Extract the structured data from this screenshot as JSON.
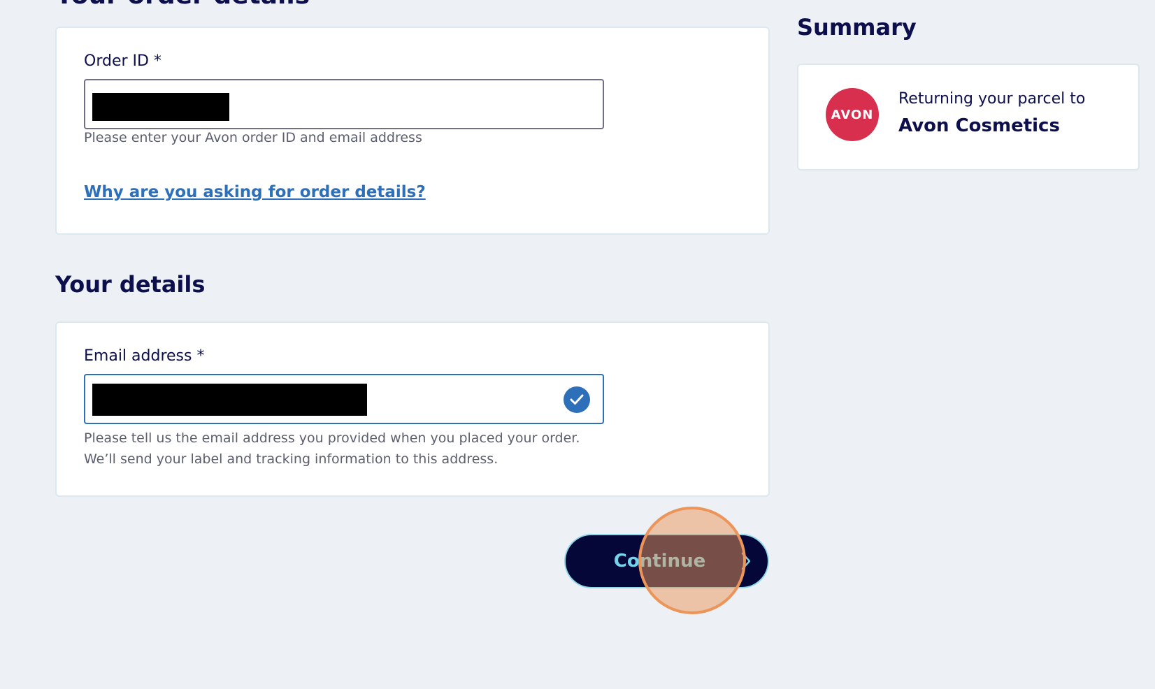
{
  "order_section": {
    "heading": "Your order details",
    "order_id_label": "Order ID *",
    "order_id_hint": "Please enter your Avon order ID and email address",
    "why_link": "Why are you asking for order details?"
  },
  "details_section": {
    "heading": "Your details",
    "email_label": "Email address *",
    "email_hint_line1": "Please tell us the email address you provided when you placed your order.",
    "email_hint_line2": "We’ll send your label and tracking information to this address."
  },
  "actions": {
    "continue_label": "Continue"
  },
  "summary": {
    "heading": "Summary",
    "logo_text": "AVON",
    "returning_text": "Returning your parcel to",
    "retailer_name": "Avon Cosmetics"
  },
  "icons": {
    "valid": "check-circle-icon",
    "continue": "chevron-right-icon"
  },
  "colors": {
    "background": "#edf1f5",
    "navy": "#0d0f4d",
    "link_blue": "#2d6fb8",
    "button_bg": "#040737",
    "button_text": "#75d2eb",
    "avon_red": "#d82f4e",
    "click_marker": "#ec955a"
  }
}
